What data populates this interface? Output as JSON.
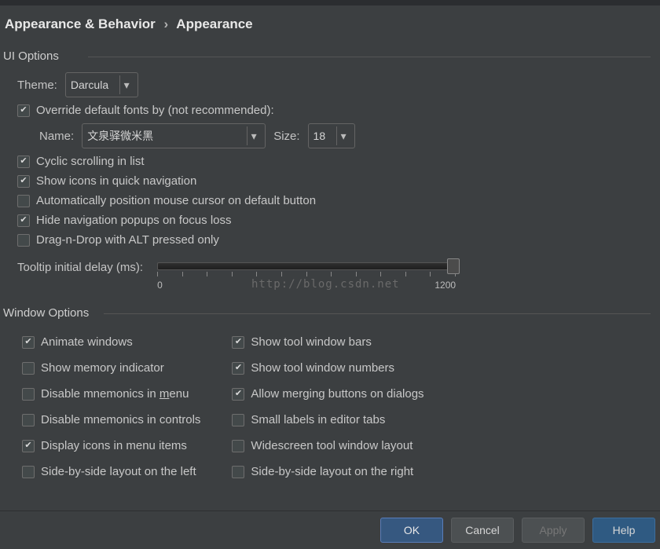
{
  "breadcrumb": {
    "a": "Appearance & Behavior",
    "sep": "›",
    "b": "Appearance"
  },
  "sections": {
    "ui": "UI Options",
    "win": "Window Options"
  },
  "theme": {
    "label": "Theme:",
    "value": "Darcula"
  },
  "font": {
    "override": "Override default fonts by (not recommended):",
    "name_label": "Name:",
    "name_value": "文泉驿微米黑",
    "size_label": "Size:",
    "size_value": "18"
  },
  "ui_checks": {
    "cyclic": {
      "label": "Cyclic scrolling in list",
      "checked": true
    },
    "icons": {
      "label": "Show icons in quick navigation",
      "checked": true
    },
    "autopos": {
      "label": "Automatically position mouse cursor on default button",
      "checked": false
    },
    "hidepop": {
      "label": "Hide navigation popups on focus loss",
      "checked": true
    },
    "dragalt": {
      "label": "Drag-n-Drop with ALT pressed only",
      "checked": false
    }
  },
  "tooltip": {
    "label": "Tooltip initial delay (ms):",
    "min": "0",
    "max": "1200"
  },
  "win_left": {
    "animate": {
      "label": "Animate windows",
      "checked": true
    },
    "memory": {
      "label": "Show memory indicator",
      "checked": false
    },
    "disMenu": {
      "pre": "Disable mnemonics in ",
      "u": "m",
      "post": "enu",
      "checked": false
    },
    "disCtrl": {
      "label": "Disable mnemonics in controls",
      "checked": false
    },
    "dispIcons": {
      "label": "Display icons in menu items",
      "checked": true
    },
    "sideLeft": {
      "label": "Side-by-side layout on the left",
      "checked": false
    }
  },
  "win_right": {
    "bars": {
      "label": "Show tool window bars",
      "checked": true
    },
    "nums": {
      "label": "Show tool window numbers",
      "checked": true
    },
    "merge": {
      "label": "Allow merging buttons on dialogs",
      "checked": true
    },
    "small": {
      "label": "Small labels in editor tabs",
      "checked": false
    },
    "wide": {
      "label": "Widescreen tool window layout",
      "checked": false
    },
    "sideRight": {
      "label": "Side-by-side layout on the right",
      "checked": false
    }
  },
  "buttons": {
    "ok": "OK",
    "cancel": "Cancel",
    "apply": "Apply",
    "help": "Help"
  },
  "watermark": "http://blog.csdn.net"
}
